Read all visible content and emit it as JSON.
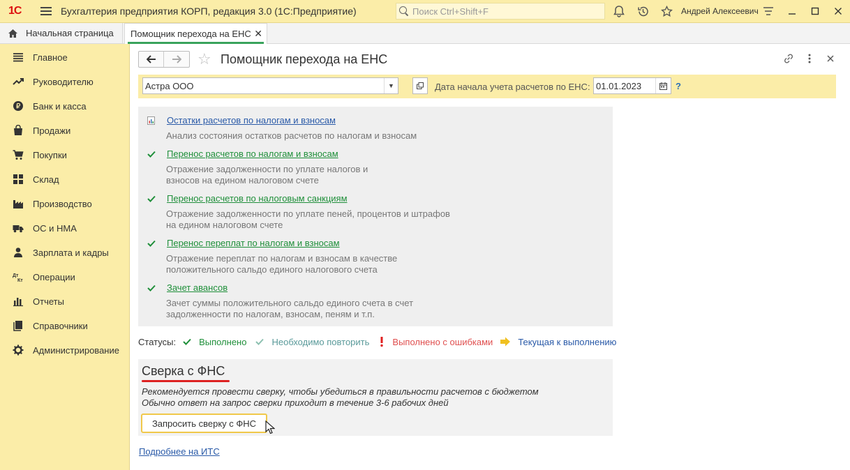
{
  "titlebar": {
    "logo": "1С",
    "app_title": "Бухгалтерия предприятия КОРП, редакция 3.0  (1С:Предприятие)",
    "search_placeholder": "Поиск Ctrl+Shift+F",
    "user": "Андрей Алексеевич"
  },
  "tabs": {
    "home": "Начальная страница",
    "active": "Помощник перехода на ЕНС"
  },
  "sidebar": {
    "items": [
      {
        "label": "Главное",
        "icon": "menu-lines-icon"
      },
      {
        "label": "Руководителю",
        "icon": "trend-icon"
      },
      {
        "label": "Банк и касса",
        "icon": "ruble-icon"
      },
      {
        "label": "Продажи",
        "icon": "shopping-bag-icon"
      },
      {
        "label": "Покупки",
        "icon": "cart-icon"
      },
      {
        "label": "Склад",
        "icon": "grid-icon"
      },
      {
        "label": "Производство",
        "icon": "factory-icon"
      },
      {
        "label": "ОС и НМА",
        "icon": "truck-icon"
      },
      {
        "label": "Зарплата и кадры",
        "icon": "person-icon"
      },
      {
        "label": "Операции",
        "icon": "dt-kt-icon"
      },
      {
        "label": "Отчеты",
        "icon": "bar-chart-icon"
      },
      {
        "label": "Справочники",
        "icon": "book-icon"
      },
      {
        "label": "Администрирование",
        "icon": "gear-icon"
      }
    ]
  },
  "form": {
    "title": "Помощник перехода на ЕНС",
    "organization": "Астра ООО",
    "date_label": "Дата начала учета расчетов по ЕНС:",
    "date_value": "01.01.2023",
    "help": "?"
  },
  "steps": [
    {
      "title": "Остатки расчетов по налогам и взносам",
      "desc": "Анализ состояния остатков расчетов по налогам и взносам",
      "status": "report"
    },
    {
      "title": "Перенос расчетов по налогам и взносам",
      "desc": "Отражение задолженности по уплате налогов и взносов на едином налоговом счете",
      "status": "done"
    },
    {
      "title": "Перенос расчетов по налоговым санкциям",
      "desc": "Отражение задолженности по уплате пеней, процентов и штрафов на едином налоговом счете",
      "status": "done"
    },
    {
      "title": "Перенос переплат по налогам и взносам",
      "desc": "Отражение переплат по налогам и взносам в качестве положительного сальдо единого налогового счета",
      "status": "done"
    },
    {
      "title": "Зачет авансов",
      "desc": "Зачет суммы положительного сальдо единого счета в счет задолженности по налогам, взносам, пеням и т.п.",
      "status": "done"
    }
  ],
  "statuses": {
    "label": "Статусы:",
    "done": "Выполнено",
    "repeat": "Необходимо повторить",
    "errors": "Выполнено с ошибками",
    "current": "Текущая к выполнению"
  },
  "colors": {
    "done": "#1f8f3a",
    "repeat": "#5a9a9a",
    "errors": "#e05050",
    "current": "#2a5aa8",
    "accent": "#fbeda8"
  },
  "sverka": {
    "title": "Сверка с ФНС",
    "line1": "Рекомендуется провести сверку, чтобы убедиться в правильности расчетов с бюджетом",
    "line2": "Обычно ответ на запрос сверки приходит в течение 3-6 рабочих дней",
    "button": "Запросить сверку с ФНС"
  },
  "more_link": "Подробнее на ИТС"
}
